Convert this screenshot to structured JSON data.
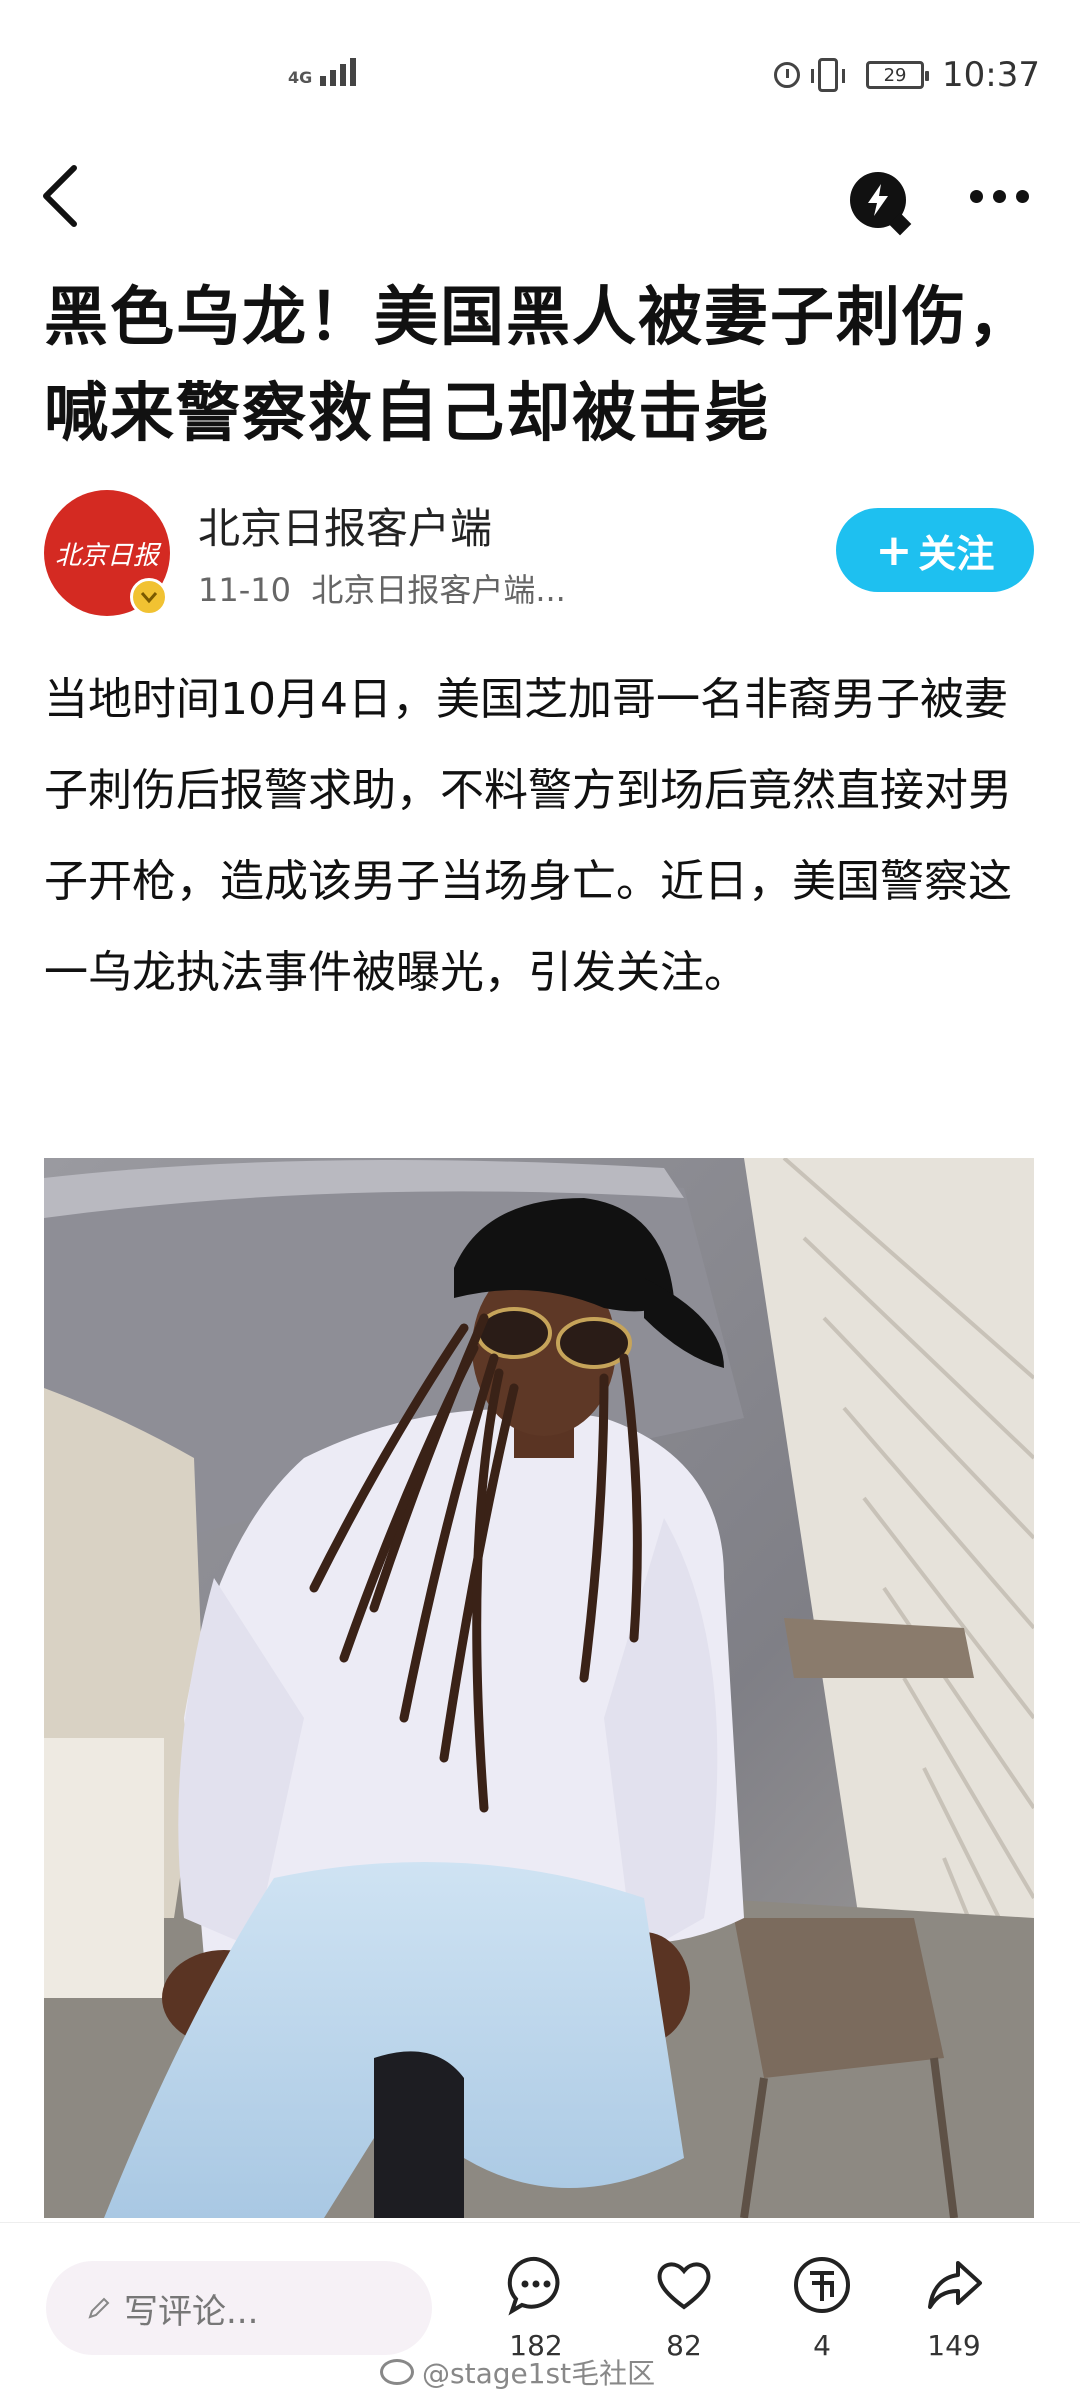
{
  "status_bar": {
    "network": "4G",
    "battery": "29",
    "time": "10:37"
  },
  "article": {
    "title": "黑色乌龙！美国黑人被妻子刺伤，喊来警察救自己却被击毙",
    "author": {
      "name": "北京日报客户端",
      "date": "11-10",
      "source": "北京日报客户端...",
      "avatar_logo": "北京日报",
      "follow_label": "关注"
    },
    "body": "当地时间10月4日，美国芝加哥一名非裔男子被妻子刺伤后报警求助，不料警方到场后竟然直接对男子开枪，造成该男子当场身亡。近日，美国警察这一乌龙执法事件被曝光，引发关注。"
  },
  "bottom_bar": {
    "comment_placeholder": "写评论...",
    "comments": "182",
    "likes": "82",
    "coins": "4",
    "shares": "149"
  },
  "watermark": "@stage1st毛社区",
  "colors": {
    "accent": "#1ec0f0",
    "avatar_bg": "#d42a22"
  },
  "icons": [
    "back-icon",
    "flash-icon",
    "more-icon",
    "comment-icon",
    "heart-icon",
    "coin-icon",
    "share-icon",
    "pen-icon"
  ]
}
